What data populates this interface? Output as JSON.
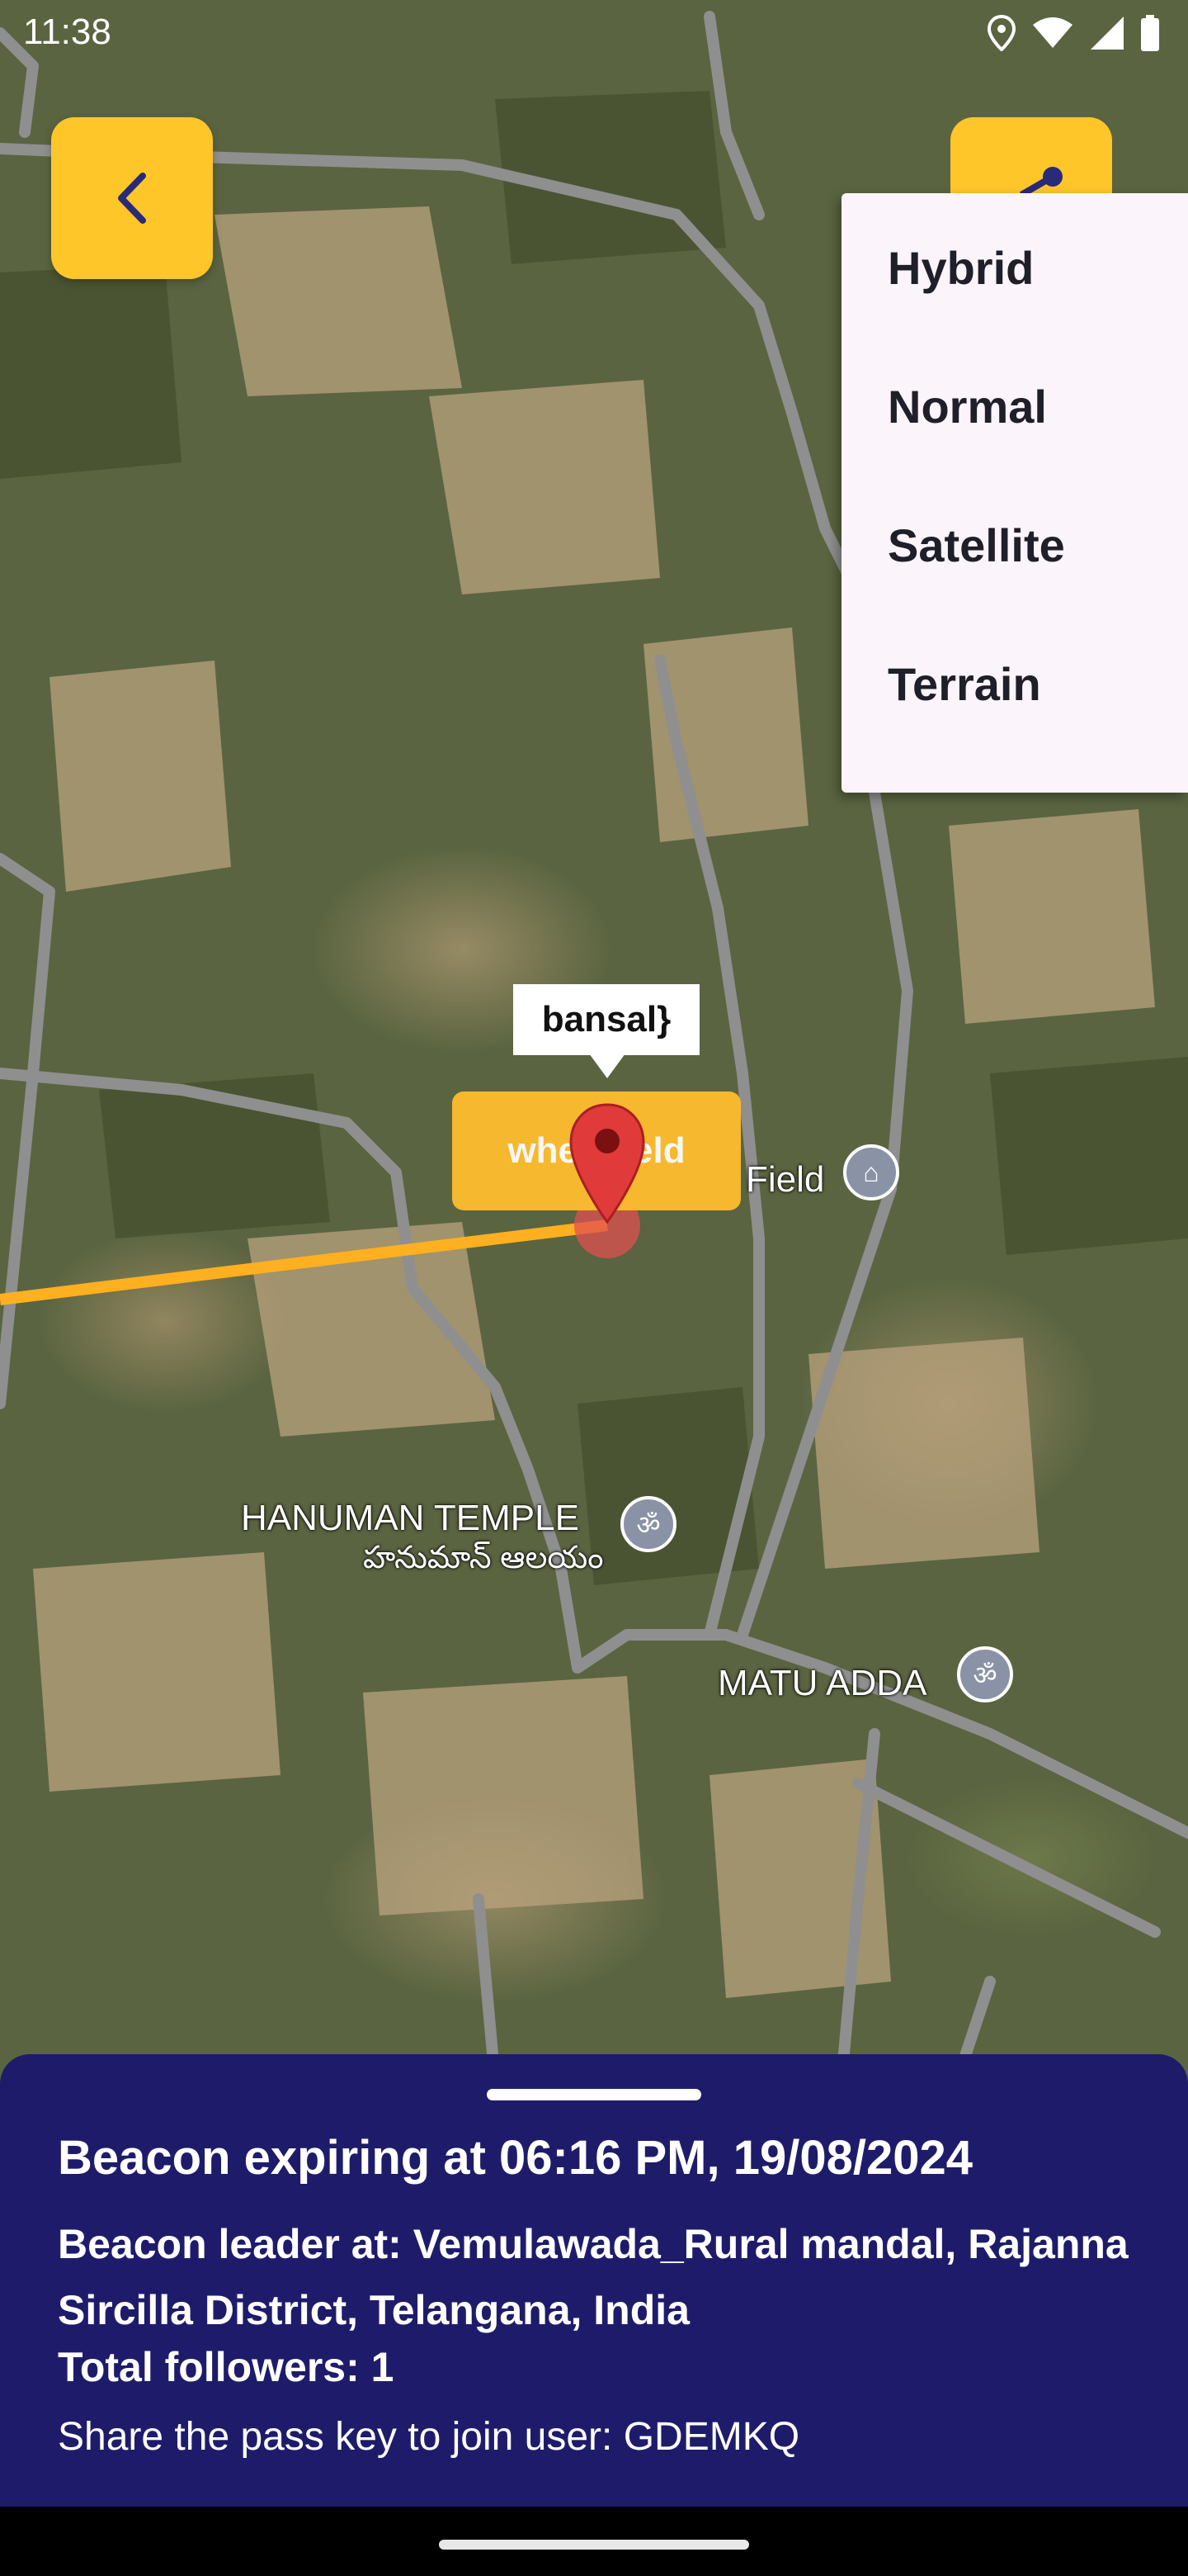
{
  "status_bar": {
    "time": "11:38",
    "icons": [
      "location-icon",
      "wifi-icon",
      "signal-icon",
      "battery-icon"
    ]
  },
  "toolbar": {
    "back_icon": "chevron-left-icon",
    "share_icon": "share-icon"
  },
  "map_type_menu": {
    "items": [
      {
        "label": "Hybrid"
      },
      {
        "label": "Normal"
      },
      {
        "label": "Satellite"
      },
      {
        "label": "Terrain"
      }
    ]
  },
  "map": {
    "marker_tooltip": "bansal}",
    "place_chip": "wheatfield",
    "labels": {
      "field": "Field",
      "temple_en": "HANUMAN TEMPLE",
      "temple_te": "హనుమాన్ ఆలయం",
      "matu_adda": "MATU ADDA"
    }
  },
  "sheet": {
    "title": "Beacon expiring at 06:16 PM, 19/08/2024",
    "location": "Beacon leader at: Vemulawada_Rural mandal, Rajanna Sircilla District, Telangana, India",
    "followers": "Total followers: 1",
    "passkey": "Share the pass key to join user: GDEMKQ"
  },
  "colors": {
    "accent": "#ffc62a",
    "sheet_bg": "#1e1c6a",
    "route": "#ffb020",
    "marker": "#e03a3a"
  }
}
